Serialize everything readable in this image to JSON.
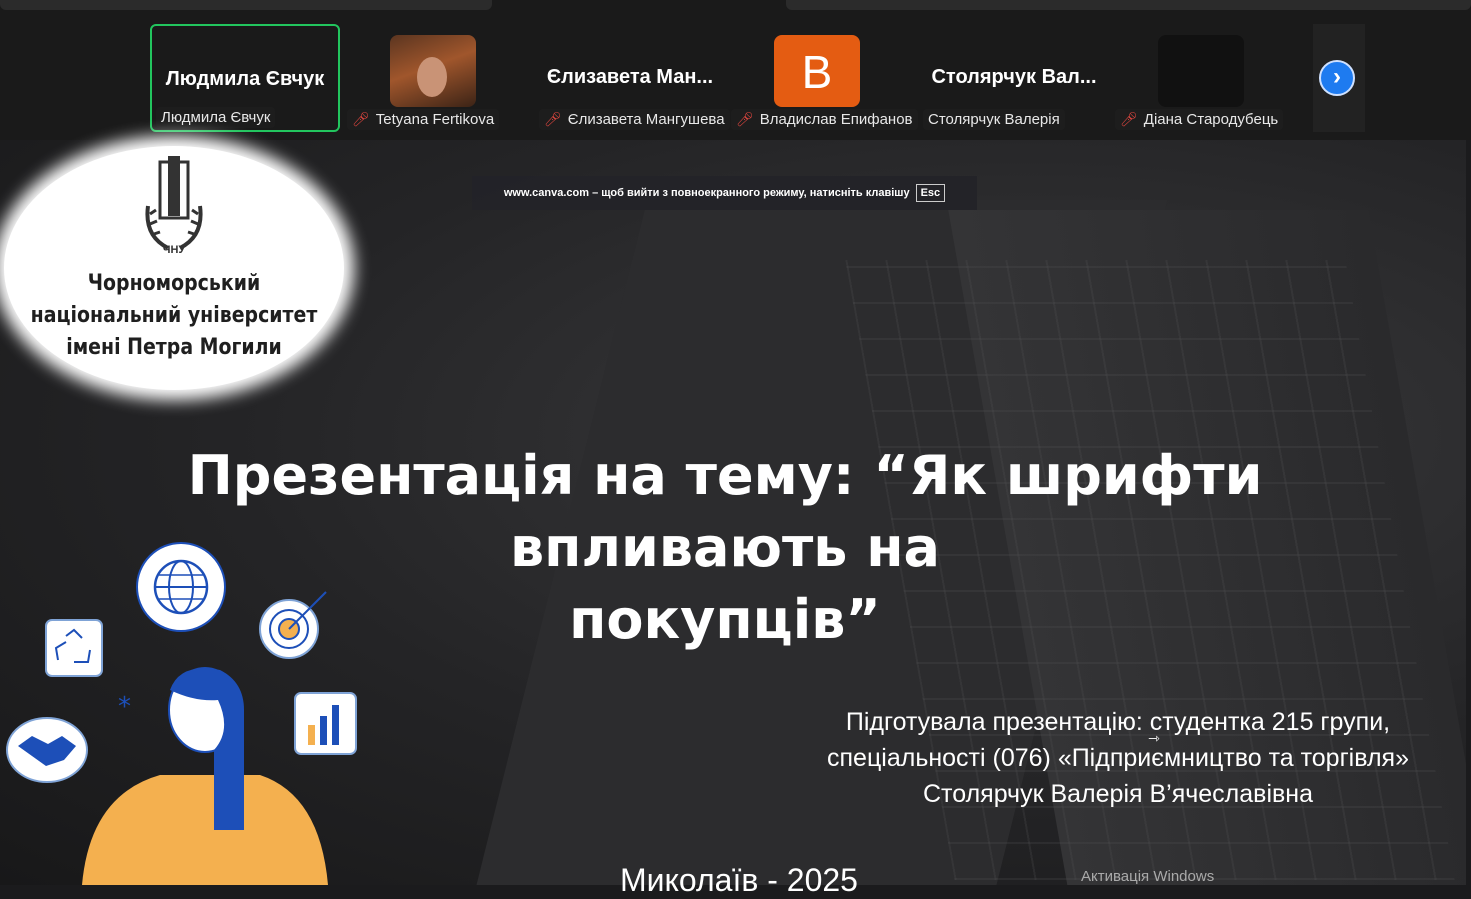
{
  "participants": [
    {
      "big_name": "Людмила Євчук",
      "label": "Людмила Євчук",
      "muted": false,
      "active": true,
      "avatar": "name"
    },
    {
      "big_name": "",
      "label": "Tetyana Fertikova",
      "muted": true,
      "active": false,
      "avatar": "photo"
    },
    {
      "big_name": "Єлизавета  Ман...",
      "label": "Єлизавета Мангушева",
      "muted": true,
      "active": false,
      "avatar": "name"
    },
    {
      "big_name": "",
      "label": "Владислав Епифанов",
      "muted": true,
      "active": false,
      "avatar": "initial",
      "initial": "B"
    },
    {
      "big_name": "Столярчук  Вал...",
      "label": "Столярчук Валерія",
      "muted": false,
      "active": false,
      "avatar": "name"
    },
    {
      "big_name": "",
      "label": "Діана Стародубець",
      "muted": true,
      "active": false,
      "avatar": "dark"
    }
  ],
  "next_icon": "chevron-right-icon",
  "fullscreen_notice": {
    "text": "www.canva.com – щоб вийти з повноекранного режиму, натисніть клавішу",
    "key": "Esc"
  },
  "logo": {
    "abbr": "ЧНУ",
    "line1": "Чорноморський",
    "line2": "національний університет",
    "line3": "імені Петра Могили"
  },
  "slide": {
    "title_line1": "Презентація на тему: “Як шрифти впливають на",
    "title_line2": "покупців”",
    "prepared_line1": "Підготувала презентацію: студентка 215 групи,",
    "prepared_line2": "спеціальності (076) «Підприємництво та торгівля»",
    "prepared_line3": "Столярчук Валерія В’ячеславівна",
    "city_year": "Миколаїв - 2025"
  },
  "watermark": "Активація Windows",
  "colors": {
    "active_border": "#22c55e",
    "mic_muted": "#e0463f",
    "next_button": "#1e7bf0",
    "initial_avatar": "#e45c12",
    "illustration_orange": "#f4b04f",
    "illustration_blue": "#1d4fb8"
  }
}
